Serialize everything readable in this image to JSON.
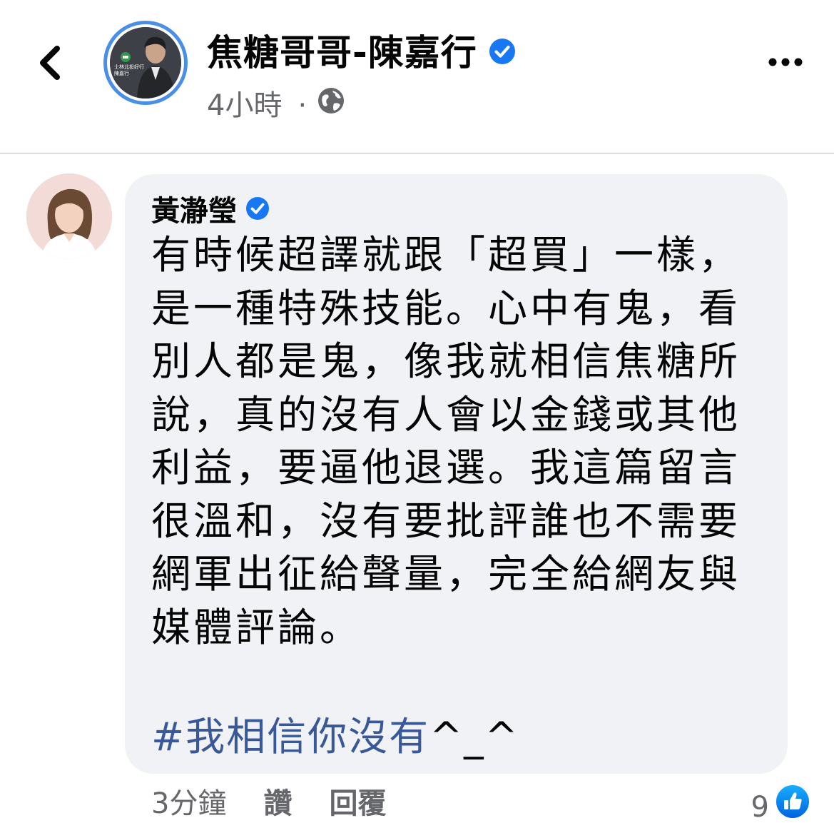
{
  "header": {
    "page_name": "焦糖哥哥-陳嘉行",
    "timestamp": "4小時",
    "separator": "·",
    "avatar_label_lines": [
      "士林北投好行",
      "陳嘉行"
    ]
  },
  "comment": {
    "author": "黃瀞瑩",
    "lines": [
      "有時候超譯就跟「超買」一樣，",
      "是一種特殊技能。心中有鬼，看",
      "別人都是鬼，像我就相信焦糖所",
      "說，真的沒有人會以金錢或其他",
      "利益，要逼他退選。我這篇留言",
      "很溫和，沒有要批評誰也不需要",
      "網軍出征給聲量，完全給網友與",
      "媒體評論。"
    ],
    "hashtag": "#我相信你沒有",
    "emote": "^_^",
    "time": "3分鐘",
    "like_label": "讚",
    "reply_label": "回覆",
    "reaction_count": "9"
  },
  "colors": {
    "verified_blue": "#1877f2",
    "hashtag_blue": "#385898",
    "bubble_bg": "#f0f2f5",
    "meta_gray": "#65676b",
    "avatar_ring": "#4a8fe6"
  },
  "icons": [
    "back-chevron-icon",
    "verified-badge-icon",
    "globe-icon",
    "more-options-icon",
    "like-reaction-icon"
  ]
}
